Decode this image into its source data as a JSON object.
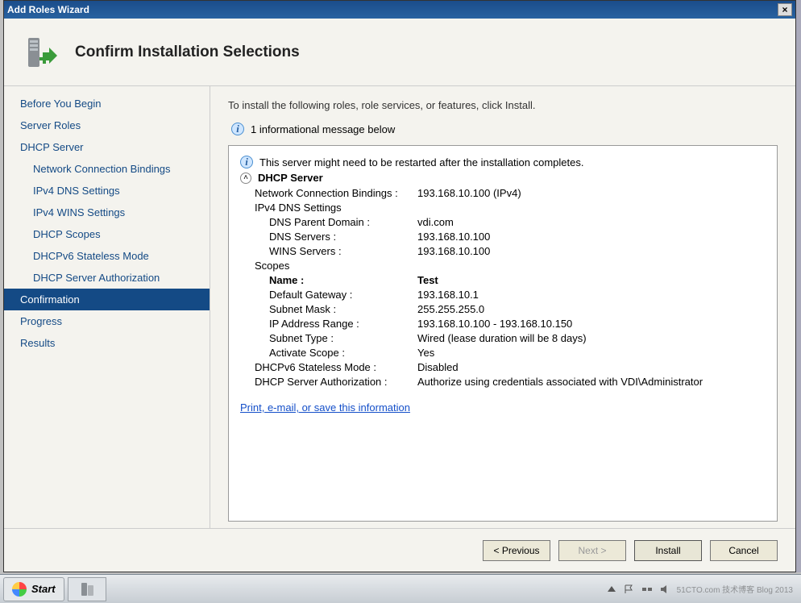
{
  "titlebar": {
    "title": "Add Roles Wizard"
  },
  "header": {
    "title": "Confirm Installation Selections"
  },
  "sidebar": {
    "items": [
      {
        "label": "Before You Begin",
        "indent": false
      },
      {
        "label": "Server Roles",
        "indent": false
      },
      {
        "label": "DHCP Server",
        "indent": false
      },
      {
        "label": "Network Connection Bindings",
        "indent": true
      },
      {
        "label": "IPv4 DNS Settings",
        "indent": true
      },
      {
        "label": "IPv4 WINS Settings",
        "indent": true
      },
      {
        "label": "DHCP Scopes",
        "indent": true
      },
      {
        "label": "DHCPv6 Stateless Mode",
        "indent": true
      },
      {
        "label": "DHCP Server Authorization",
        "indent": true
      },
      {
        "label": "Confirmation",
        "indent": false,
        "selected": true
      },
      {
        "label": "Progress",
        "indent": false
      },
      {
        "label": "Results",
        "indent": false
      }
    ]
  },
  "main": {
    "instruction": "To install the following roles, role services, or features, click Install.",
    "info_msg": "1 informational message below",
    "restart_note": "This server might need to be restarted after the installation completes.",
    "section": "DHCP Server",
    "rows": {
      "ncb_k": "Network Connection Bindings :",
      "ncb_v": "193.168.10.100 (IPv4)",
      "ipv4dns_header": "IPv4 DNS Settings",
      "dns_parent_k": "DNS Parent Domain :",
      "dns_parent_v": "vdi.com",
      "dns_servers_k": "DNS Servers :",
      "dns_servers_v": "193.168.10.100",
      "wins_k": "WINS Servers :",
      "wins_v": "193.168.10.100",
      "scopes_header": "Scopes",
      "name_k": "Name :",
      "name_v": "Test",
      "gw_k": "Default Gateway :",
      "gw_v": "193.168.10.1",
      "mask_k": "Subnet Mask :",
      "mask_v": "255.255.255.0",
      "range_k": "IP Address Range :",
      "range_v": "193.168.10.100 - 193.168.10.150",
      "subnet_type_k": "Subnet Type :",
      "subnet_type_v": "Wired (lease duration will be 8 days)",
      "activate_k": "Activate Scope :",
      "activate_v": "Yes",
      "v6_k": "DHCPv6 Stateless Mode :",
      "v6_v": "Disabled",
      "auth_k": "DHCP Server Authorization :",
      "auth_v": "Authorize using credentials associated with VDI\\Administrator"
    },
    "link": "Print, e-mail, or save this information"
  },
  "footer": {
    "previous": "< Previous",
    "next": "Next >",
    "install": "Install",
    "cancel": "Cancel"
  },
  "taskbar": {
    "start": "Start"
  },
  "watermark": "51CTO.com 技术博客 Blog 2013"
}
